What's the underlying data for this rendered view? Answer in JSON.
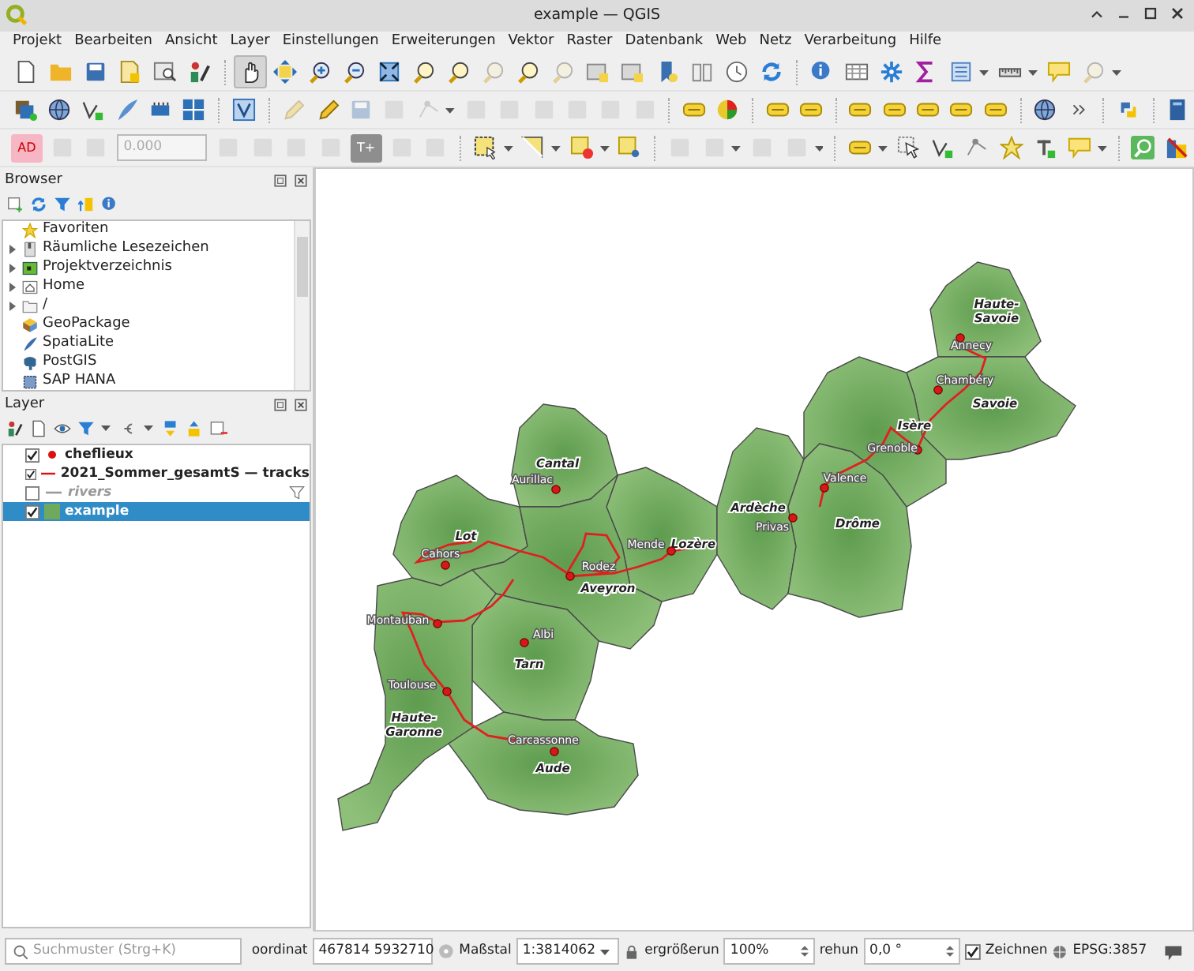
{
  "window": {
    "title": "example — QGIS"
  },
  "menu": [
    "Projekt",
    "Bearbeiten",
    "Ansicht",
    "Layer",
    "Einstellungen",
    "Erweiterungen",
    "Vektor",
    "Raster",
    "Datenbank",
    "Web",
    "Netz",
    "Verarbeitung",
    "Hilfe"
  ],
  "toolbars": [
    {
      "items": [
        {
          "kind": "tool",
          "disabled": false,
          "active": false
        },
        {
          "kind": "tool",
          "disabled": false,
          "active": false
        },
        {
          "kind": "tool",
          "disabled": false,
          "active": false
        },
        {
          "kind": "tool",
          "disabled": false,
          "active": false
        },
        {
          "kind": "tool",
          "disabled": false,
          "active": false
        },
        {
          "kind": "tool",
          "disabled": false,
          "active": false
        },
        {
          "kind": "tool",
          "disabled": false,
          "active": true
        },
        {
          "kind": "tool",
          "disabled": false,
          "active": false
        },
        {
          "kind": "tool",
          "disabled": false,
          "active": false
        },
        {
          "kind": "tool",
          "disabled": false,
          "active": false
        },
        {
          "kind": "tool",
          "disabled": false,
          "active": false
        },
        {
          "kind": "tool",
          "disabled": false,
          "active": false
        },
        {
          "kind": "tool",
          "disabled": false,
          "active": false
        },
        {
          "kind": "tool",
          "disabled": true,
          "active": false
        },
        {
          "kind": "tool",
          "disabled": false,
          "active": false
        },
        {
          "kind": "tool",
          "disabled": true,
          "active": false
        },
        {
          "kind": "tool",
          "disabled": false,
          "active": false
        },
        {
          "kind": "tool",
          "disabled": false,
          "active": false
        },
        {
          "kind": "tool",
          "disabled": false,
          "active": false
        },
        {
          "kind": "tool",
          "disabled": false,
          "active": false
        },
        {
          "kind": "tool",
          "disabled": false,
          "active": false
        },
        {
          "kind": "tool",
          "disabled": false,
          "active": false
        },
        {
          "kind": "tool",
          "disabled": false,
          "active": false
        },
        {
          "kind": "tool",
          "disabled": false,
          "active": false
        },
        {
          "kind": "tool",
          "disabled": false,
          "active": false
        },
        {
          "kind": "tool",
          "disabled": false,
          "active": false
        },
        {
          "kind": "tool",
          "disabled": false,
          "active": false
        },
        {
          "kind": "tool",
          "disabled": false,
          "active": false
        },
        {
          "kind": "tool",
          "disabled": false,
          "active": false
        },
        {
          "kind": "tool",
          "disabled": true,
          "active": false
        }
      ]
    },
    {
      "items": [
        {
          "kind": "tool",
          "disabled": false
        },
        {
          "kind": "tool",
          "disabled": false
        },
        {
          "kind": "tool",
          "disabled": false
        },
        {
          "kind": "tool",
          "disabled": false
        },
        {
          "kind": "tool",
          "disabled": false
        },
        {
          "kind": "tool",
          "disabled": false
        },
        {
          "kind": "tool",
          "disabled": false
        },
        {
          "kind": "tool",
          "disabled": true
        },
        {
          "kind": "tool",
          "disabled": false
        },
        {
          "kind": "tool",
          "disabled": true
        },
        {
          "kind": "tool",
          "disabled": true
        },
        {
          "kind": "tool",
          "disabled": true
        },
        {
          "kind": "tool",
          "disabled": true
        },
        {
          "kind": "tool",
          "disabled": true
        },
        {
          "kind": "tool",
          "disabled": true
        },
        {
          "kind": "tool",
          "disabled": true
        },
        {
          "kind": "tool",
          "disabled": true
        },
        {
          "kind": "tool",
          "disabled": true
        },
        {
          "kind": "tool",
          "disabled": false
        },
        {
          "kind": "tool",
          "disabled": false
        },
        {
          "kind": "tool",
          "disabled": false
        },
        {
          "kind": "tool",
          "disabled": false
        },
        {
          "kind": "tool",
          "disabled": false
        },
        {
          "kind": "tool",
          "disabled": false
        },
        {
          "kind": "tool",
          "disabled": false
        },
        {
          "kind": "tool",
          "disabled": false
        },
        {
          "kind": "tool",
          "disabled": false
        },
        {
          "kind": "tool",
          "disabled": false
        },
        {
          "kind": "tool",
          "disabled": false
        },
        {
          "kind": "tool",
          "disabled": false
        },
        {
          "kind": "tool",
          "disabled": false
        }
      ]
    },
    {
      "items": [
        {
          "kind": "text",
          "label": "AD",
          "disabled": false
        },
        {
          "kind": "tool",
          "disabled": true
        },
        {
          "kind": "tool",
          "disabled": true
        },
        {
          "kind": "field",
          "value": "0.000",
          "disabled": true
        },
        {
          "kind": "tool",
          "disabled": true
        },
        {
          "kind": "tool",
          "disabled": true
        },
        {
          "kind": "tool",
          "disabled": true
        },
        {
          "kind": "tool",
          "disabled": true
        },
        {
          "kind": "text",
          "label": "T+",
          "disabled": false
        },
        {
          "kind": "tool",
          "disabled": true
        },
        {
          "kind": "tool",
          "disabled": true
        },
        {
          "kind": "tool",
          "disabled": false
        },
        {
          "kind": "tool",
          "disabled": false
        },
        {
          "kind": "tool",
          "disabled": false
        },
        {
          "kind": "tool",
          "disabled": false
        },
        {
          "kind": "tool",
          "disabled": true
        },
        {
          "kind": "tool",
          "disabled": true
        },
        {
          "kind": "tool",
          "disabled": true
        },
        {
          "kind": "tool",
          "disabled": true
        },
        {
          "kind": "tool",
          "disabled": false
        },
        {
          "kind": "tool",
          "disabled": false
        },
        {
          "kind": "tool",
          "disabled": false
        },
        {
          "kind": "tool",
          "disabled": false
        },
        {
          "kind": "tool",
          "disabled": false
        },
        {
          "kind": "tool",
          "disabled": false
        },
        {
          "kind": "tool",
          "disabled": false
        },
        {
          "kind": "tool",
          "disabled": false
        },
        {
          "kind": "tool",
          "disabled": false
        }
      ]
    }
  ],
  "browser": {
    "title": "Browser",
    "items": [
      {
        "label": "Favoriten",
        "expandable": false
      },
      {
        "label": "Räumliche Lesezeichen",
        "expandable": true
      },
      {
        "label": "Projektverzeichnis",
        "expandable": true
      },
      {
        "label": "Home",
        "expandable": true
      },
      {
        "label": "/",
        "expandable": true
      },
      {
        "label": "GeoPackage",
        "expandable": false
      },
      {
        "label": "SpatiaLite",
        "expandable": false
      },
      {
        "label": "PostGIS",
        "expandable": false
      },
      {
        "label": "SAP HANA",
        "expandable": false
      }
    ]
  },
  "layers": {
    "title": "Layer",
    "items": [
      {
        "name": "cheflieux",
        "kind": "point",
        "checked": true,
        "selected": false,
        "filtered": false
      },
      {
        "name": "2021_Sommer_gesamtS — tracks",
        "kind": "line",
        "checked": true,
        "selected": false,
        "filtered": false
      },
      {
        "name": "rivers",
        "kind": "line",
        "checked": false,
        "selected": false,
        "filtered": true
      },
      {
        "name": "example",
        "kind": "polygon",
        "checked": true,
        "selected": true,
        "filtered": false
      }
    ]
  },
  "map": {
    "departments": [
      {
        "label": "Haute-Savoie"
      },
      {
        "label": "Savoie"
      },
      {
        "label": "Isère"
      },
      {
        "label": "Cantal"
      },
      {
        "label": "Lot"
      },
      {
        "label": "Lozère"
      },
      {
        "label": "Ardèche"
      },
      {
        "label": "Drôme"
      },
      {
        "label": "Aveyron"
      },
      {
        "label": "Tarn"
      },
      {
        "label": "Haute-Garonne"
      },
      {
        "label": "Aude"
      }
    ],
    "cities": [
      {
        "label": "Annecy"
      },
      {
        "label": "Chambéry"
      },
      {
        "label": "Grenoble"
      },
      {
        "label": "Valence"
      },
      {
        "label": "Aurillac"
      },
      {
        "label": "Privas"
      },
      {
        "label": "Cahors"
      },
      {
        "label": "Mende"
      },
      {
        "label": "Rodez"
      },
      {
        "label": "Montauban"
      },
      {
        "label": "Albi"
      },
      {
        "label": "Toulouse"
      },
      {
        "label": "Carcassonne"
      }
    ]
  },
  "status_bar": {
    "search_placeholder": "Suchmuster (Strg+K)",
    "coordinate_label": "oordinat",
    "coordinate": "467814 5932710",
    "scale_label": "Maßstal",
    "scale": "1:3814062",
    "magnifier_label": "ergrößerun",
    "magnifier": "100%",
    "rotation_label": "rehun",
    "rotation": "0,0 °",
    "render_label": "Zeichnen",
    "render_checked": true,
    "crs": "EPSG:3857"
  }
}
